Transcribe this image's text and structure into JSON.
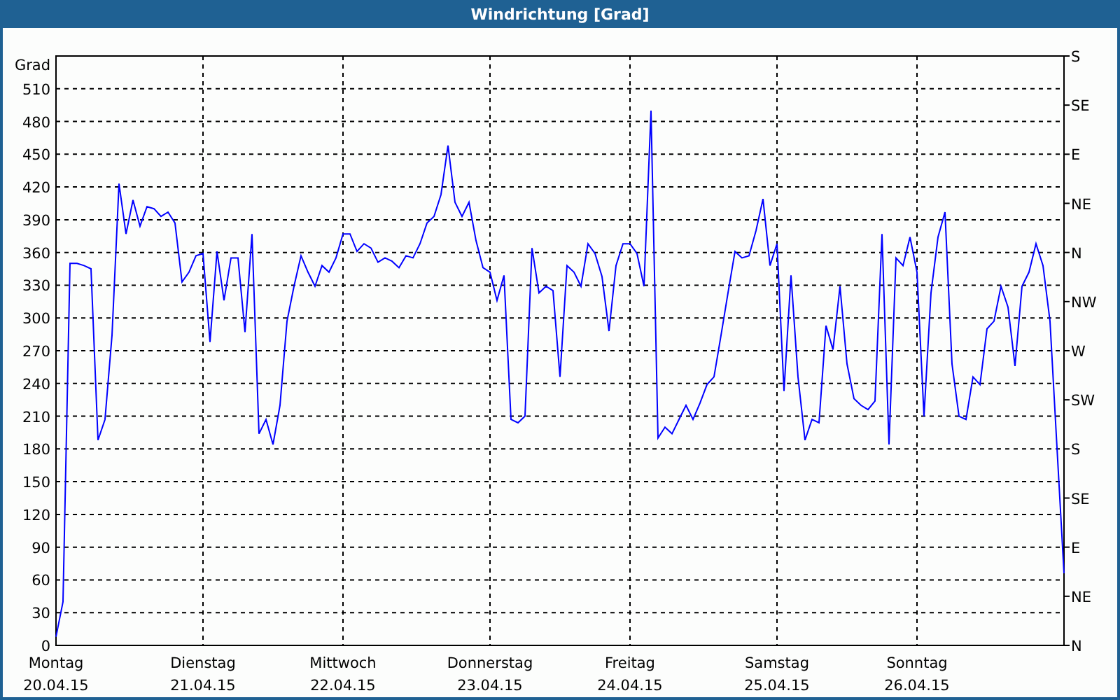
{
  "window": {
    "title": "Windrichtung [Grad]"
  },
  "chart": {
    "right_axis": [
      "S",
      "SE",
      "E",
      "NE",
      "N",
      "NW",
      "W",
      "SW",
      "S",
      "SE",
      "E",
      "NE",
      "N"
    ],
    "chart_data": {
      "type": "line",
      "grid": true,
      "ylabel": "Grad",
      "ylim": [
        0,
        540
      ],
      "yticks": [
        0,
        30,
        60,
        90,
        120,
        150,
        180,
        210,
        240,
        270,
        300,
        330,
        360,
        390,
        420,
        450,
        480,
        510
      ],
      "categories": [
        "Montag 20.04.15",
        null,
        null,
        null,
        null,
        null,
        null,
        null,
        null,
        null,
        null,
        null,
        null,
        null,
        null,
        null,
        null,
        null,
        null,
        null,
        null,
        "Dienstag 21.04.15",
        null,
        null,
        null,
        null,
        null,
        null,
        null,
        null,
        null,
        null,
        null,
        null,
        null,
        null,
        null,
        null,
        null,
        null,
        null,
        "Mittwoch 22.04.15",
        null,
        null,
        null,
        null,
        null,
        null,
        null,
        null,
        null,
        null,
        null,
        null,
        null,
        null,
        null,
        null,
        null,
        null,
        null,
        null,
        "Donnerstag 23.04.15",
        null,
        null,
        null,
        null,
        null,
        null,
        null,
        null,
        null,
        null,
        null,
        null,
        null,
        null,
        null,
        null,
        null,
        null,
        null,
        "Freitag 24.04.15",
        null,
        null,
        null,
        null,
        null,
        null,
        null,
        null,
        null,
        null,
        null,
        null,
        null,
        null,
        null,
        null,
        null,
        null,
        null,
        null,
        "Samstag 25.04.15",
        null,
        null,
        null,
        null,
        null,
        null,
        null,
        null,
        null,
        null,
        null,
        null,
        null,
        null,
        null,
        null,
        null,
        null,
        null,
        "Sonntag 26.04.15",
        null,
        null,
        null,
        null,
        null,
        null,
        null,
        null,
        null,
        null,
        null,
        null,
        null,
        null,
        null,
        null,
        null,
        null,
        null,
        null,
        null
      ],
      "series": [
        {
          "color": "#0000ff",
          "values": [
            8,
            40,
            350,
            350,
            348,
            345,
            188,
            207,
            284,
            423,
            377,
            408,
            384,
            402,
            400,
            393,
            397,
            387,
            333,
            342,
            357,
            359,
            278,
            361,
            316,
            355,
            355,
            287,
            377,
            194,
            207,
            184,
            220,
            297,
            329,
            357,
            342,
            329,
            348,
            342,
            355,
            377,
            377,
            361,
            368,
            364,
            351,
            355,
            352,
            346,
            357,
            355,
            368,
            387,
            393,
            413,
            458,
            406,
            393,
            406,
            371,
            346,
            342,
            316,
            339,
            207,
            204,
            210,
            364,
            323,
            329,
            325,
            246,
            348,
            342,
            329,
            368,
            359,
            338,
            288,
            348,
            368,
            368,
            359,
            329,
            490,
            190,
            200,
            194,
            207,
            220,
            207,
            222,
            239,
            246,
            284,
            323,
            361,
            355,
            357,
            380,
            409,
            348,
            368,
            233,
            339,
            246,
            188,
            207,
            204,
            293,
            271,
            329,
            258,
            226,
            220,
            216,
            224,
            377,
            184,
            355,
            348,
            374,
            342,
            210,
            323,
            374,
            397,
            258,
            210,
            207,
            246,
            239,
            290,
            297,
            329,
            310,
            256,
            329,
            342,
            368,
            348,
            297,
            181,
            66
          ]
        }
      ]
    }
  }
}
